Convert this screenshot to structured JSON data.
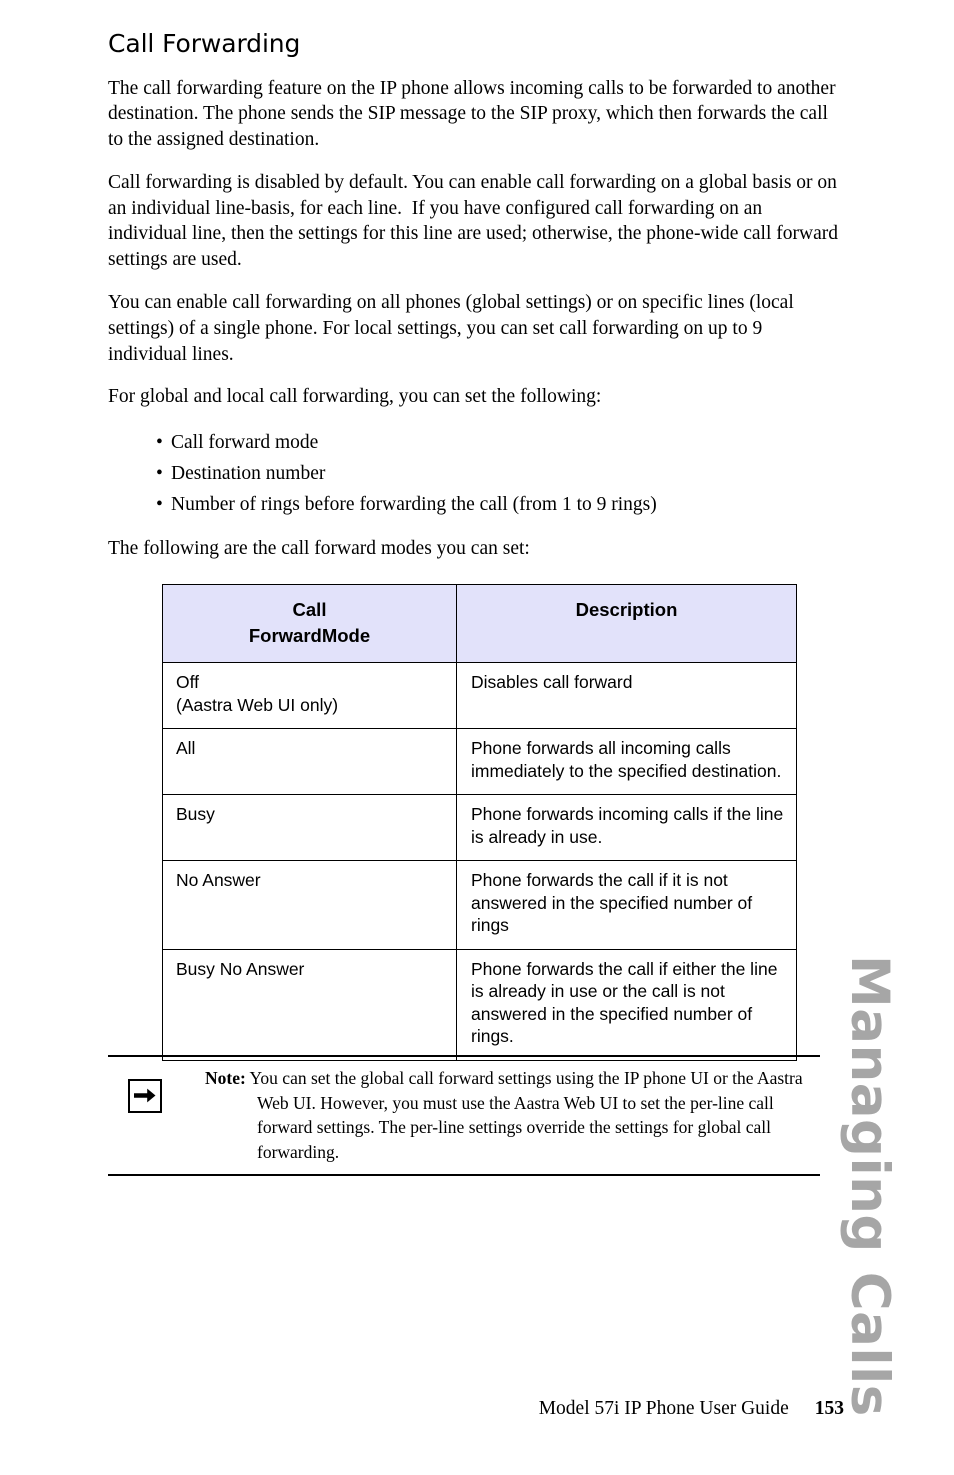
{
  "heading": "Call Forwarding",
  "paragraphs": [
    "The call forwarding feature on the IP phone allows incoming calls to be forwarded to another destination. The phone sends the SIP message to the SIP proxy, which then forwards the call to the assigned destination.",
    "Call forwarding is disabled by default. You can enable call forwarding on a global basis or on an individual line-basis, for each line.  If you have configured call forwarding on an individual line, then the settings for this line are used; otherwise, the phone-wide call forward settings are used.",
    "You can enable call forwarding on all phones (global settings) or on specific lines (local settings) of a single phone. For local settings, you can set call forwarding on up to 9 individual lines.",
    "For global and local call forwarding, you can set the following:"
  ],
  "bullets": [
    "Call forward mode",
    "Destination number",
    "Number of rings before forwarding the call (from 1 to 9 rings)"
  ],
  "intro_table": "The following are the call forward modes you can set:",
  "table": {
    "headers": {
      "col1_line1": "Call",
      "col1_line2": "ForwardMode",
      "col2": "Description"
    },
    "header_bg": "#E2E2FA",
    "rows": [
      {
        "mode_line1": "Off",
        "mode_line2": "(Aastra Web UI only)",
        "description": "Disables call forward"
      },
      {
        "mode_line1": "All",
        "mode_line2": "",
        "description": "Phone forwards all incoming calls immediately to the specified destination."
      },
      {
        "mode_line1": "Busy",
        "mode_line2": "",
        "description": "Phone forwards incoming calls if the line is already in use."
      },
      {
        "mode_line1": "No Answer",
        "mode_line2": "",
        "description": "Phone forwards the call if it is not answered in the specified number of rings"
      },
      {
        "mode_line1": "Busy No Answer",
        "mode_line2": "",
        "description": "Phone forwards the call if either the line is already in use or the call is not answered in the specified number of rings."
      }
    ]
  },
  "note": {
    "label": "Note:",
    "text": "You can set the global call forward settings using the IP phone UI or the Aastra Web UI. However, you must use the Aastra Web UI to set the per-line call forward settings. The per-line settings override the settings for global call forwarding.",
    "icon": "right-arrow-icon"
  },
  "side_tab": {
    "label": "Managing Calls",
    "color": "#a6a6a6"
  },
  "footer": {
    "guide_title": "Model 57i IP Phone User Guide",
    "page_number": "153"
  }
}
